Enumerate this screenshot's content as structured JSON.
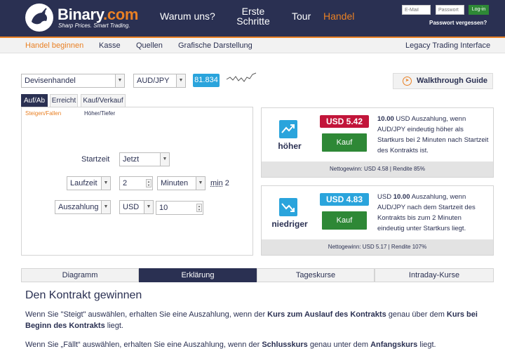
{
  "header": {
    "brand_name": "Binary",
    "brand_tld": ".com",
    "tagline": "Sharp Prices. Smart Trading.",
    "nav": {
      "why": "Warum uns?",
      "first_steps_1": "Erste",
      "first_steps_2": "Schritte",
      "tour": "Tour",
      "trade": "Handel"
    },
    "login": {
      "email_placeholder": "E-Mail",
      "password_placeholder": "Passwort",
      "login_label": "Log-in",
      "forgot_label": "Passwort vergessen?"
    }
  },
  "subnav": {
    "start_trading": "Handel beginnen",
    "cashier": "Kasse",
    "sources": "Quellen",
    "charting": "Grafische Darstellung",
    "legacy": "Legacy Trading Interface"
  },
  "controls": {
    "market": "Devisenhandel",
    "asset": "AUD/JPY",
    "spot": "81.834",
    "walkthrough": "Walkthrough Guide"
  },
  "trade_tabs": {
    "up_down": "Auf/Ab",
    "touch": "Erreicht",
    "buy_sell": "Kauf/Verkauf"
  },
  "sub_tabs": {
    "rise_fall": "Steigen/Fallen",
    "higher_lower": "Höher/Tiefer"
  },
  "form": {
    "start_time_label": "Startzeit",
    "start_time_value": "Jetzt",
    "duration_label": "Laufzeit",
    "duration_value": "2",
    "duration_unit": "Minuten",
    "min_prefix": "min",
    "min_value": "2",
    "payout_label": "Auszahlung",
    "currency": "USD",
    "amount": "10"
  },
  "contracts": {
    "higher": {
      "label": "höher",
      "price": "USD 5.42",
      "buy": "Kauf",
      "desc_amount": "10.00",
      "desc_rest": " USD Auszahlung, wenn AUD/JPY eindeutig höher als Startkurs bei 2 Minuten nach Startzeit des Kontrakts ist.",
      "footer": "Nettogewinn: USD 4.58 | Rendite 85%"
    },
    "lower": {
      "label": "niedriger",
      "price": "USD 4.83",
      "buy": "Kauf",
      "desc_prefix": "USD ",
      "desc_amount": "10.00",
      "desc_rest": " Auszahlung, wenn AUD/JPY nach dem Startzeit des Kontrakts bis zum 2 Minuten eindeutig unter Startkurs liegt.",
      "footer": "Nettogewinn: USD 5.17 | Rendite 107%"
    }
  },
  "bottom_tabs": {
    "chart": "Diagramm",
    "explanation": "Erklärung",
    "daily": "Tageskurse",
    "intraday": "Intraday-Kurse"
  },
  "content": {
    "title": "Den Kontrakt gewinnen",
    "p1": {
      "a": "Wenn Sie \"Steigt\" auswählen, erhalten Sie eine Auszahlung, wenn der ",
      "b": "Kurs zum Auslauf des Kontrakts",
      "c": " genau über dem ",
      "d": "Kurs bei Beginn des Kontrakts",
      "e": " liegt."
    },
    "p2": {
      "a": "Wenn Sie „Fällt“ auswählen, erhalten Sie eine Auszahlung, wenn der ",
      "b": "Schlusskurs",
      "c": " genau unter dem ",
      "d": "Anfangskurs",
      "e": " liegt."
    }
  },
  "colors": {
    "navy": "#2a3052",
    "orange": "#e98024",
    "green": "#2e8836",
    "red": "#c2153a",
    "blue": "#2aa4dc"
  }
}
